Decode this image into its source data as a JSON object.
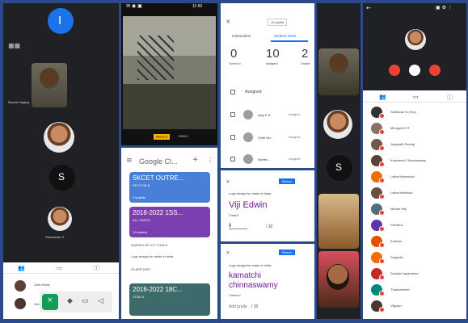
{
  "meet1": {
    "avatar_letter": "I",
    "presenter_name": "Ramesh Nagaraj",
    "participant_name": "Saravanan D",
    "tabs": [
      "people-icon",
      "chat-icon",
      "info-icon"
    ],
    "list": [
      {
        "name": "Jeeth Reddy"
      },
      {
        "name": "Srinivasa Rao"
      }
    ]
  },
  "camera": {
    "time": "11:50",
    "mode_left": "PHOTO",
    "mode_right": "VIDEO"
  },
  "classroom_home": {
    "title": "Google Cl...",
    "cards": [
      {
        "title": "SKCET OUTRE...",
        "sub": "SECTION B",
        "count": "5 students",
        "color": "#4a7fd8"
      },
      {
        "title": "2018-2022 1SS...",
        "sub": "ALL 1SACH",
        "count": "12 students",
        "color": "#7b3fb0"
      },
      {
        "title": "2018-2022 18C...",
        "sub": "VCSE A",
        "count": "",
        "color": "#3d6a6a"
      }
    ],
    "stream": [
      "SURVEY OF ICT TOOLS",
      "Logo design for make in india",
      "23 APR 2020"
    ]
  },
  "student_work": {
    "points": "10 points",
    "tabs": [
      "Instructions",
      "Student Work"
    ],
    "stats": [
      {
        "num": "0",
        "label": "Turned in"
      },
      {
        "num": "10",
        "label": "Assigned"
      },
      {
        "num": "2",
        "label": "Graded"
      }
    ],
    "section": "Assigned",
    "students": [
      {
        "name": "Ajay K R",
        "status": "Assigned"
      },
      {
        "name": "Chitti Mu...",
        "status": "Assigned"
      },
      {
        "name": "Mahes...",
        "status": "Assigned"
      }
    ]
  },
  "grade1": {
    "return_label": "Return",
    "assignment": "Logo design for make in india",
    "student": "Viji Edwin",
    "state": "Graded",
    "grade": "8",
    "out_of": "/ 10"
  },
  "grade2": {
    "return_label": "Return",
    "assignment": "Logo design for make in india",
    "student": "kamatchi chinnaswamy",
    "state": "Turned in",
    "add_grade": "Add grade",
    "out_of": "/ 10"
  },
  "meet2": {
    "people": []
  },
  "meet3": {
    "participants": [
      {
        "name": "Sridharan N (You)",
        "color": "#333"
      },
      {
        "name": "Murugan K R",
        "color": "#8d6e63"
      },
      {
        "name": "Jeganath Paulraj",
        "color": "#795548"
      },
      {
        "name": "Kamalesh Chinnaswamy",
        "color": "#5d4037"
      },
      {
        "name": "Latha Maheshan",
        "color": "#ef6c00"
      },
      {
        "name": "Latha Mahesan",
        "color": "#6d4c41"
      },
      {
        "name": "Mohan Raj",
        "color": "#546e7a"
      },
      {
        "name": "Pavithra..",
        "color": "#5e35b1"
      },
      {
        "name": "Kamala",
        "color": "#e65100"
      },
      {
        "name": "Suganthi",
        "color": "#ef6c00"
      },
      {
        "name": "Sundari Jayaraman",
        "color": "#c62828"
      },
      {
        "name": "Thamizhselvi",
        "color": "#00897b"
      },
      {
        "name": "Vijiyasri",
        "color": "#4e342e"
      }
    ]
  }
}
